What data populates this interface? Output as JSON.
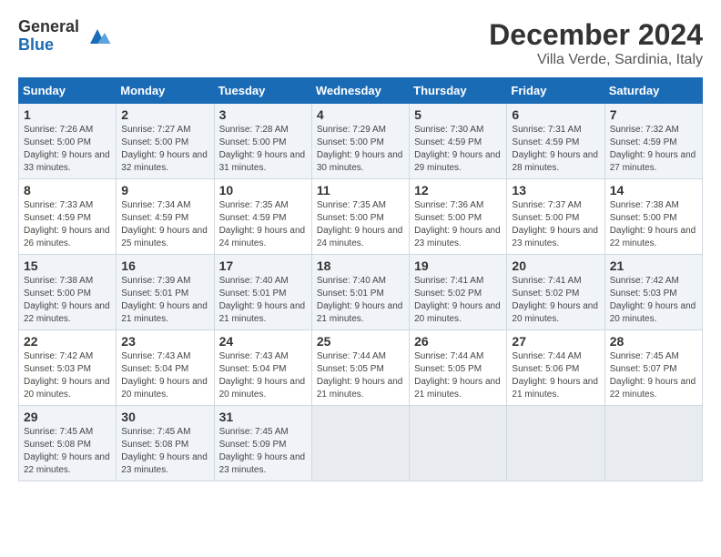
{
  "logo": {
    "general": "General",
    "blue": "Blue"
  },
  "title": "December 2024",
  "location": "Villa Verde, Sardinia, Italy",
  "days_of_week": [
    "Sunday",
    "Monday",
    "Tuesday",
    "Wednesday",
    "Thursday",
    "Friday",
    "Saturday"
  ],
  "weeks": [
    [
      {
        "day": "1",
        "sunrise": "7:26 AM",
        "sunset": "5:00 PM",
        "daylight": "9 hours and 33 minutes."
      },
      {
        "day": "2",
        "sunrise": "7:27 AM",
        "sunset": "5:00 PM",
        "daylight": "9 hours and 32 minutes."
      },
      {
        "day": "3",
        "sunrise": "7:28 AM",
        "sunset": "5:00 PM",
        "daylight": "9 hours and 31 minutes."
      },
      {
        "day": "4",
        "sunrise": "7:29 AM",
        "sunset": "5:00 PM",
        "daylight": "9 hours and 30 minutes."
      },
      {
        "day": "5",
        "sunrise": "7:30 AM",
        "sunset": "4:59 PM",
        "daylight": "9 hours and 29 minutes."
      },
      {
        "day": "6",
        "sunrise": "7:31 AM",
        "sunset": "4:59 PM",
        "daylight": "9 hours and 28 minutes."
      },
      {
        "day": "7",
        "sunrise": "7:32 AM",
        "sunset": "4:59 PM",
        "daylight": "9 hours and 27 minutes."
      }
    ],
    [
      {
        "day": "8",
        "sunrise": "7:33 AM",
        "sunset": "4:59 PM",
        "daylight": "9 hours and 26 minutes."
      },
      {
        "day": "9",
        "sunrise": "7:34 AM",
        "sunset": "4:59 PM",
        "daylight": "9 hours and 25 minutes."
      },
      {
        "day": "10",
        "sunrise": "7:35 AM",
        "sunset": "4:59 PM",
        "daylight": "9 hours and 24 minutes."
      },
      {
        "day": "11",
        "sunrise": "7:35 AM",
        "sunset": "5:00 PM",
        "daylight": "9 hours and 24 minutes."
      },
      {
        "day": "12",
        "sunrise": "7:36 AM",
        "sunset": "5:00 PM",
        "daylight": "9 hours and 23 minutes."
      },
      {
        "day": "13",
        "sunrise": "7:37 AM",
        "sunset": "5:00 PM",
        "daylight": "9 hours and 23 minutes."
      },
      {
        "day": "14",
        "sunrise": "7:38 AM",
        "sunset": "5:00 PM",
        "daylight": "9 hours and 22 minutes."
      }
    ],
    [
      {
        "day": "15",
        "sunrise": "7:38 AM",
        "sunset": "5:00 PM",
        "daylight": "9 hours and 22 minutes."
      },
      {
        "day": "16",
        "sunrise": "7:39 AM",
        "sunset": "5:01 PM",
        "daylight": "9 hours and 21 minutes."
      },
      {
        "day": "17",
        "sunrise": "7:40 AM",
        "sunset": "5:01 PM",
        "daylight": "9 hours and 21 minutes."
      },
      {
        "day": "18",
        "sunrise": "7:40 AM",
        "sunset": "5:01 PM",
        "daylight": "9 hours and 21 minutes."
      },
      {
        "day": "19",
        "sunrise": "7:41 AM",
        "sunset": "5:02 PM",
        "daylight": "9 hours and 20 minutes."
      },
      {
        "day": "20",
        "sunrise": "7:41 AM",
        "sunset": "5:02 PM",
        "daylight": "9 hours and 20 minutes."
      },
      {
        "day": "21",
        "sunrise": "7:42 AM",
        "sunset": "5:03 PM",
        "daylight": "9 hours and 20 minutes."
      }
    ],
    [
      {
        "day": "22",
        "sunrise": "7:42 AM",
        "sunset": "5:03 PM",
        "daylight": "9 hours and 20 minutes."
      },
      {
        "day": "23",
        "sunrise": "7:43 AM",
        "sunset": "5:04 PM",
        "daylight": "9 hours and 20 minutes."
      },
      {
        "day": "24",
        "sunrise": "7:43 AM",
        "sunset": "5:04 PM",
        "daylight": "9 hours and 20 minutes."
      },
      {
        "day": "25",
        "sunrise": "7:44 AM",
        "sunset": "5:05 PM",
        "daylight": "9 hours and 21 minutes."
      },
      {
        "day": "26",
        "sunrise": "7:44 AM",
        "sunset": "5:05 PM",
        "daylight": "9 hours and 21 minutes."
      },
      {
        "day": "27",
        "sunrise": "7:44 AM",
        "sunset": "5:06 PM",
        "daylight": "9 hours and 21 minutes."
      },
      {
        "day": "28",
        "sunrise": "7:45 AM",
        "sunset": "5:07 PM",
        "daylight": "9 hours and 22 minutes."
      }
    ],
    [
      {
        "day": "29",
        "sunrise": "7:45 AM",
        "sunset": "5:08 PM",
        "daylight": "9 hours and 22 minutes."
      },
      {
        "day": "30",
        "sunrise": "7:45 AM",
        "sunset": "5:08 PM",
        "daylight": "9 hours and 23 minutes."
      },
      {
        "day": "31",
        "sunrise": "7:45 AM",
        "sunset": "5:09 PM",
        "daylight": "9 hours and 23 minutes."
      },
      null,
      null,
      null,
      null
    ]
  ],
  "labels": {
    "sunrise": "Sunrise:",
    "sunset": "Sunset:",
    "daylight": "Daylight:"
  }
}
